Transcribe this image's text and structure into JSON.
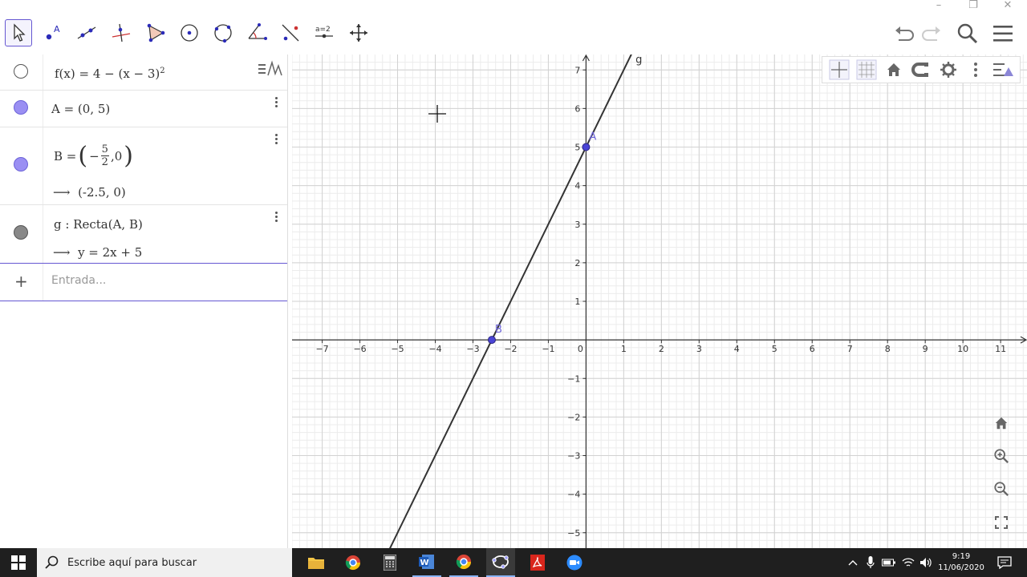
{
  "window": {
    "minimize": "–",
    "restore": "❐",
    "close": "✕"
  },
  "toolbar": {
    "tools": [
      "move-tool",
      "point-tool",
      "line-tool",
      "perpendicular-line-tool",
      "polygon-tool",
      "circle-center-point-tool",
      "circle-three-points-tool",
      "angle-tool",
      "reflect-tool",
      "slider-tool",
      "move-graphics-view-tool"
    ],
    "slider_label": "a=2"
  },
  "algebra": {
    "rows": [
      {
        "name": "f",
        "color": "#ffffff",
        "border": "#555555",
        "expr": "f(x) = 4 − (x − 3)",
        "sup": "2"
      },
      {
        "name": "A",
        "color": "#9a8ff3",
        "border": "#6c63d8",
        "expr": "A = (0, 5)"
      },
      {
        "name": "B",
        "color": "#9a8ff3",
        "border": "#6c63d8",
        "expr_prefix": "B = ",
        "frac_num": "5",
        "frac_den": "2",
        "frac_sign": "−",
        "frac_rest": ",0",
        "value": "(-2.5, 0)"
      },
      {
        "name": "g",
        "color": "#888888",
        "border": "#555555",
        "expr": "g : Recta(A, B)",
        "value": "y = 2x + 5"
      }
    ],
    "arrow": "⟶",
    "input_placeholder": "Entrada...",
    "add_symbol": "+"
  },
  "graph": {
    "x_ticks": [
      "−7",
      "−6",
      "−5",
      "−4",
      "−3",
      "−2",
      "−1",
      "0",
      "1",
      "2",
      "3",
      "4",
      "5",
      "6",
      "7",
      "8",
      "9",
      "10",
      "11"
    ],
    "y_ticks": [
      "7",
      "6",
      "5",
      "4",
      "3",
      "2",
      "1",
      "−1",
      "−2",
      "−3",
      "−4",
      "−5"
    ],
    "x_range": [
      -7.8,
      11.7
    ],
    "y_range": [
      -5.4,
      7.4
    ],
    "point_A": {
      "label": "A",
      "x": 0,
      "y": 5
    },
    "point_B": {
      "label": "B",
      "x": -2.5,
      "y": 0
    },
    "line_g": {
      "label": "g",
      "slope": 2,
      "intercept": 5
    },
    "point_color": "#4b45d6",
    "label_color": "#6c63d8"
  },
  "taskbar": {
    "search_placeholder": "Escribe aquí para buscar",
    "time": "9:19",
    "date": "11/06/2020"
  }
}
